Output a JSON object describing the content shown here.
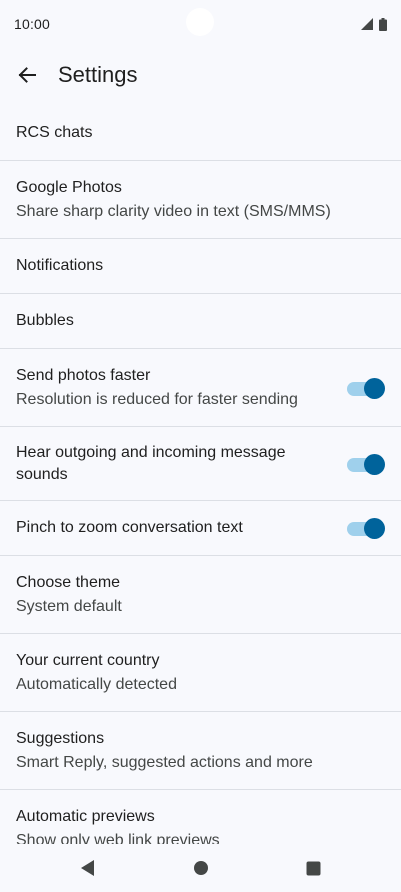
{
  "status_bar": {
    "time": "10:00"
  },
  "app_bar": {
    "title": "Settings"
  },
  "settings": [
    {
      "title": "RCS chats"
    },
    {
      "title": "Google Photos",
      "subtitle": "Share sharp clarity video in text (SMS/MMS)"
    },
    {
      "title": "Notifications"
    },
    {
      "title": "Bubbles"
    },
    {
      "title": "Send photos faster",
      "subtitle": "Resolution is reduced for faster sending",
      "toggle_on": true
    },
    {
      "title": "Hear outgoing and incoming message sounds",
      "toggle_on": true
    },
    {
      "title": "Pinch to zoom conversation text",
      "toggle_on": true
    },
    {
      "title": "Choose theme",
      "subtitle": "System default"
    },
    {
      "title": "Your current country",
      "subtitle": "Automatically detected"
    },
    {
      "title": "Suggestions",
      "subtitle": "Smart Reply, suggested actions and more"
    },
    {
      "title": "Automatic previews",
      "subtitle": "Show only web link previews"
    }
  ],
  "colors": {
    "accent": "#00639b",
    "track": "#9fd0ec",
    "background": "#f8f9fd",
    "divider": "#dcdfe5"
  },
  "icons": {
    "back": "arrow-back-icon",
    "signal": "signal-icon",
    "battery": "battery-icon",
    "nav_back": "triangle-back-icon",
    "nav_home": "circle-home-icon",
    "nav_recents": "square-recents-icon"
  }
}
